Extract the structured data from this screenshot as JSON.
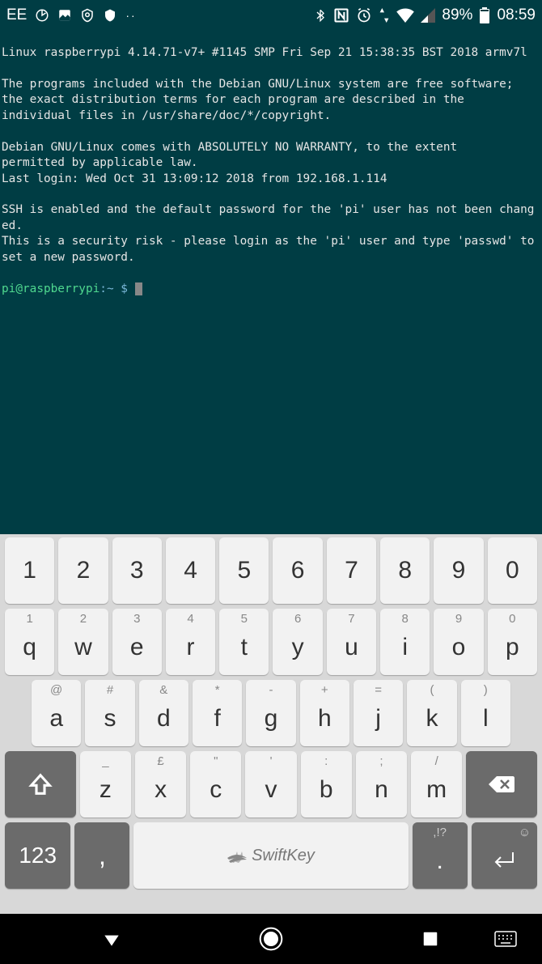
{
  "status": {
    "carrier": "EE",
    "battery": "89%",
    "time": "08:59"
  },
  "terminal": {
    "lines": [
      "Linux raspberrypi 4.14.71-v7+ #1145 SMP Fri Sep 21 15:38:35 BST 2018 armv7l",
      "",
      "The programs included with the Debian GNU/Linux system are free software;",
      "the exact distribution terms for each program are described in the",
      "individual files in /usr/share/doc/*/copyright.",
      "",
      "Debian GNU/Linux comes with ABSOLUTELY NO WARRANTY, to the extent",
      "permitted by applicable law.",
      "Last login: Wed Oct 31 13:09:12 2018 from 192.168.1.114",
      "",
      "SSH is enabled and the default password for the 'pi' user has not been changed.",
      "This is a security risk - please login as the 'pi' user and type 'passwd' to set a new password.",
      ""
    ],
    "prompt_user": "pi@raspberrypi",
    "prompt_path": ":~ $ "
  },
  "keyboard": {
    "row1": [
      "1",
      "2",
      "3",
      "4",
      "5",
      "6",
      "7",
      "8",
      "9",
      "0"
    ],
    "row2": [
      {
        "sup": "1",
        "main": "q"
      },
      {
        "sup": "2",
        "main": "w"
      },
      {
        "sup": "3",
        "main": "e"
      },
      {
        "sup": "4",
        "main": "r"
      },
      {
        "sup": "5",
        "main": "t"
      },
      {
        "sup": "6",
        "main": "y"
      },
      {
        "sup": "7",
        "main": "u"
      },
      {
        "sup": "8",
        "main": "i"
      },
      {
        "sup": "9",
        "main": "o"
      },
      {
        "sup": "0",
        "main": "p"
      }
    ],
    "row3": [
      {
        "sup": "@",
        "main": "a"
      },
      {
        "sup": "#",
        "main": "s"
      },
      {
        "sup": "&",
        "main": "d"
      },
      {
        "sup": "*",
        "main": "f"
      },
      {
        "sup": "-",
        "main": "g"
      },
      {
        "sup": "+",
        "main": "h"
      },
      {
        "sup": "=",
        "main": "j"
      },
      {
        "sup": "(",
        "main": "k"
      },
      {
        "sup": ")",
        "main": "l"
      }
    ],
    "row4": [
      {
        "sup": "_",
        "main": "z"
      },
      {
        "sup": "£",
        "main": "x"
      },
      {
        "sup": "\"",
        "main": "c"
      },
      {
        "sup": "'",
        "main": "v"
      },
      {
        "sup": ":",
        "main": "b"
      },
      {
        "sup": ";",
        "main": "n"
      },
      {
        "sup": "/",
        "main": "m"
      }
    ],
    "symbols_key": "123",
    "comma_key": ",",
    "space_label": "SwiftKey",
    "period_sup": ",!?",
    "period_main": ".",
    "enter_sup": "☺"
  }
}
